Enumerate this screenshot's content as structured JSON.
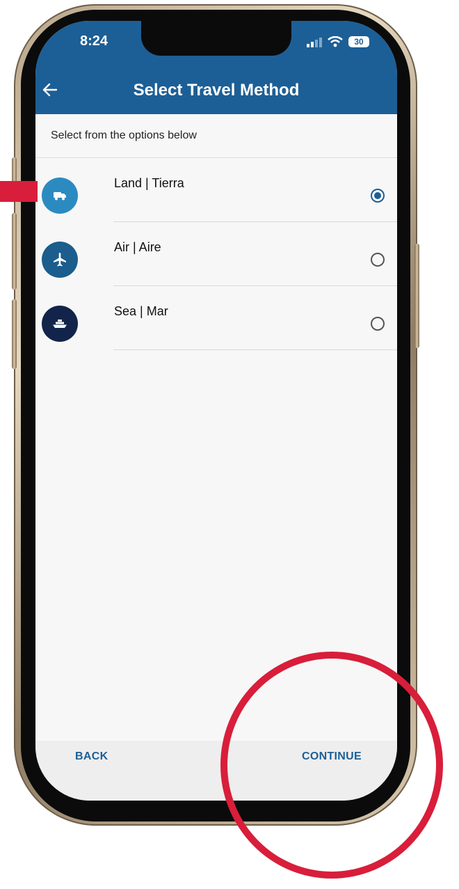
{
  "status_bar": {
    "time": "8:24",
    "battery": "30"
  },
  "header": {
    "title": "Select Travel Method",
    "back_icon": "arrow-left-icon"
  },
  "subtitle": "Select from the options below",
  "options": [
    {
      "label": "Land | Tierra",
      "icon": "truck-icon",
      "icon_color": "#2b8bc1",
      "selected": true
    },
    {
      "label": "Air | Aire",
      "icon": "airplane-icon",
      "icon_color": "#1b5d8c",
      "selected": false
    },
    {
      "label": "Sea | Mar",
      "icon": "ship-icon",
      "icon_color": "#12244a",
      "selected": false
    }
  ],
  "footer": {
    "back_label": "BACK",
    "continue_label": "CONTINUE"
  },
  "colors": {
    "header": "#1c5f96",
    "accent": "#1c5f96",
    "annotation": "#d81e3a"
  }
}
